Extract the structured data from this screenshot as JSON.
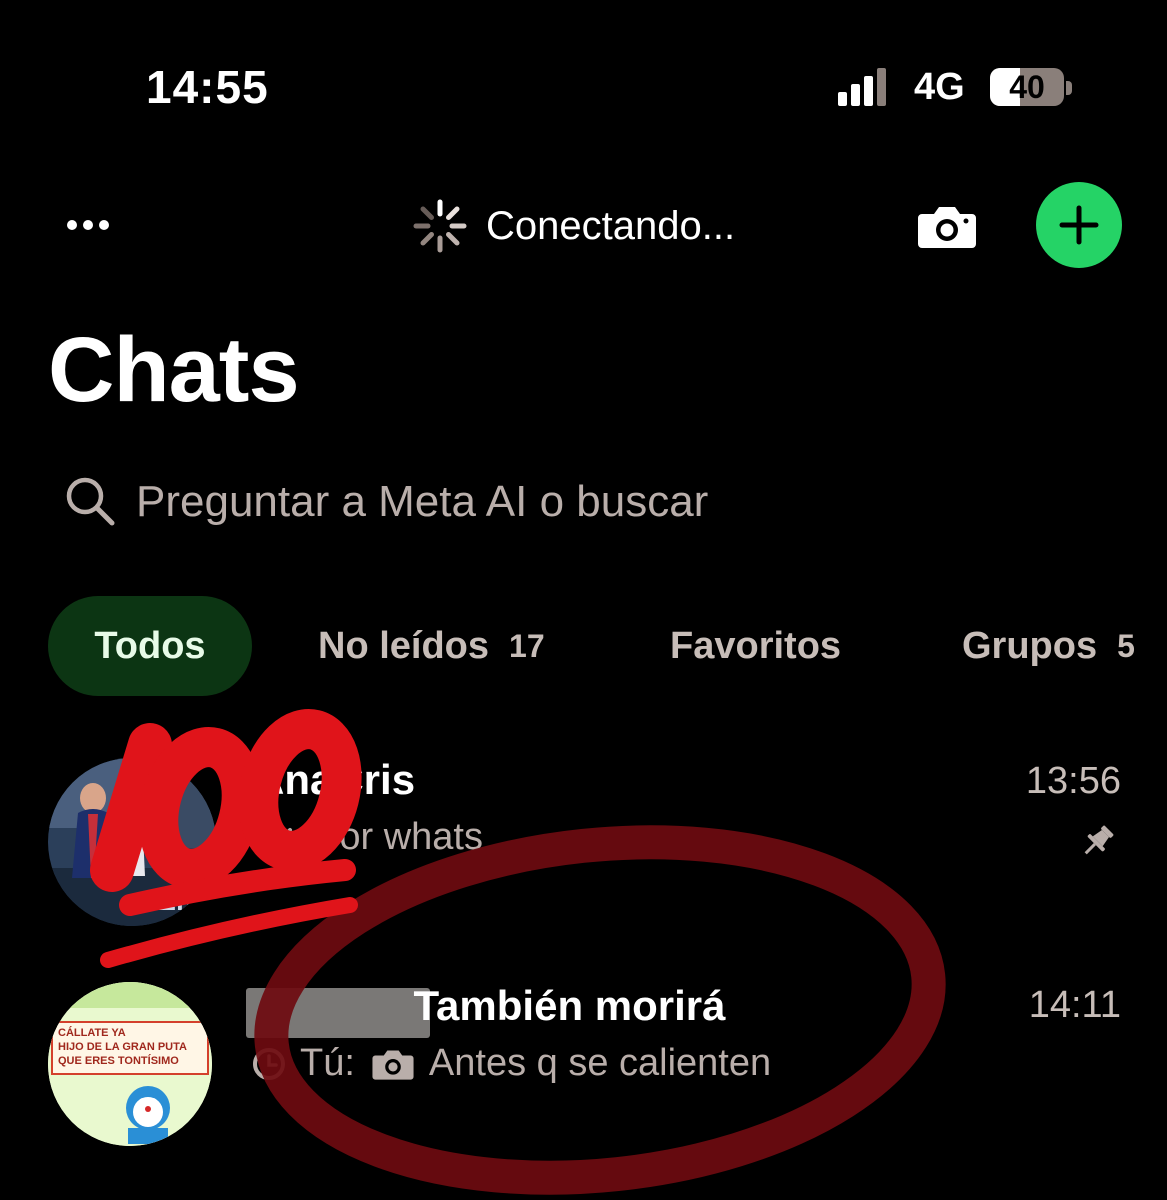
{
  "status_bar": {
    "time": "14:55",
    "network": "4G",
    "battery_level": "40",
    "battery_fraction": 0.4,
    "signal_bars_filled": 3,
    "signal_bars_total": 4
  },
  "top_bar": {
    "more_icon": "ellipsis-icon",
    "connecting_icon": "spinner-icon",
    "connecting_label": "Conectando...",
    "camera_icon": "camera-icon",
    "new_chat_icon": "plus-icon"
  },
  "page_title": "Chats",
  "search": {
    "icon": "search-icon",
    "placeholder": "Preguntar a Meta AI o buscar"
  },
  "filters": [
    {
      "label": "Todos",
      "count": "",
      "active": true
    },
    {
      "label": "No leídos",
      "count": "17",
      "active": false
    },
    {
      "label": "Favoritos",
      "count": "",
      "active": false
    },
    {
      "label": "Grupos",
      "count": "5",
      "active": false
    }
  ],
  "chats": [
    {
      "name": "AnaCris",
      "time": "13:56",
      "preview": "Por whats",
      "status_icon": "double-check-icon",
      "pinned": true,
      "pin_icon": "pin-icon"
    },
    {
      "name": "También morirá",
      "time": "14:11",
      "sender": "Tú:",
      "preview": "Antes q se calienten",
      "timer_icon": "timer-icon",
      "media_icon": "camera-icon",
      "avatar_text": [
        "CÁLLATE YA",
        "HIJO DE LA GRAN PUTA",
        "QUE ERES TONTÍSIMO"
      ]
    }
  ],
  "annotation": {
    "text": "100",
    "color": "#e0141a",
    "circle_color": "#6e0b10"
  },
  "colors": {
    "accent": "#25d366",
    "active_chip_bg": "#0c3513",
    "secondary_text": "#b9aeaa"
  }
}
